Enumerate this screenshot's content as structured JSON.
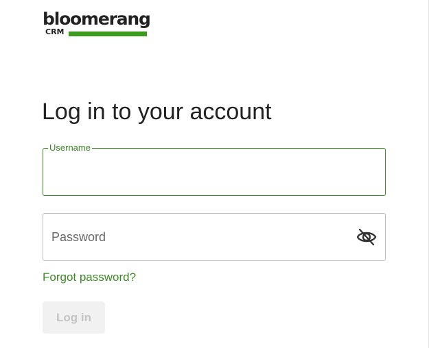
{
  "brand": {
    "wordmark": "bloomerang",
    "submark": "CRM",
    "accent_color": "#3c9a1e",
    "text_color": "#222222"
  },
  "login": {
    "title": "Log in to your account",
    "username": {
      "label": "Username",
      "value": ""
    },
    "password": {
      "placeholder": "Password",
      "value": "",
      "toggle_icon": "eye-off-icon"
    },
    "forgot_link": "Forgot password?",
    "submit_label": "Log in",
    "link_color": "#3c8a24"
  }
}
